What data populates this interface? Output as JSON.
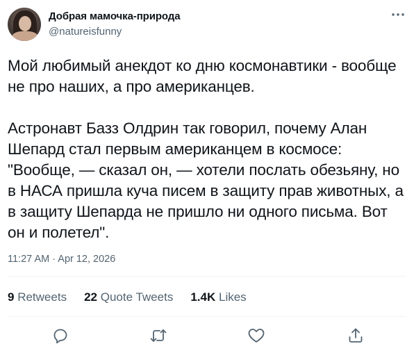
{
  "author": {
    "display_name": "Добрая мамочка-природа",
    "handle": "@natureisfunny"
  },
  "tweet": {
    "paragraph_1": "Мой любимый анекдот ко дню космонавтики - вообще не про наших, а про американцев.",
    "paragraph_2": "Астронавт Базз Олдрин так говорил, почему Алан Шепард стал первым американцем в космосе: \"Вообще, — сказал он, — хотели послать обезьяну, но в НАСА пришла куча писем в защиту прав животных, а в защиту Шепарда не пришло ни одного письма. Вот он и полетел\".",
    "timestamp": "11:27 AM · Apr 12, 2026"
  },
  "stats": {
    "retweets_count": "9",
    "retweets_label": "Retweets",
    "quotes_count": "22",
    "quotes_label": "Quote Tweets",
    "likes_count": "1.4K",
    "likes_label": "Likes"
  },
  "icons": {
    "more": "more-horizontal-icon",
    "reply": "reply-icon",
    "retweet": "retweet-icon",
    "like": "heart-icon",
    "share": "share-icon"
  },
  "colors": {
    "text": "#0f1419",
    "secondary": "#536471",
    "divider": "#eff3f4"
  }
}
